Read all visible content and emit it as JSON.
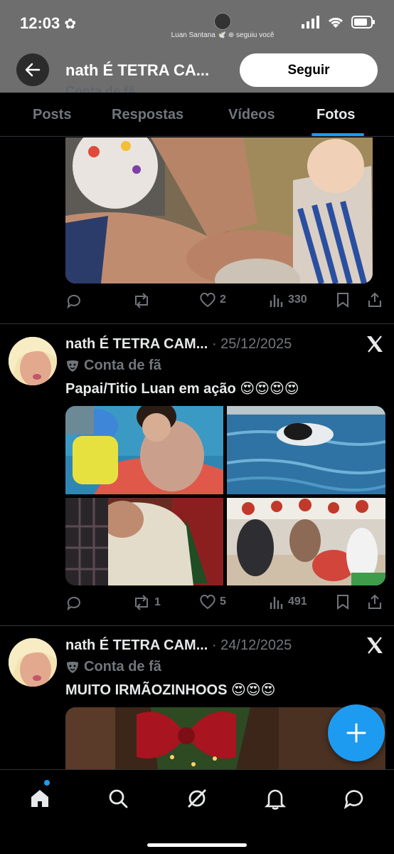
{
  "status_bar": {
    "time": "12:03"
  },
  "notification": {
    "text": "Luan Santana 🕊️ ⊕ seguiu você"
  },
  "header": {
    "title": "nath É TETRA CA...",
    "follow_label": "Seguir",
    "subtitle": "Conta de fã"
  },
  "tabs": [
    {
      "label": "Posts"
    },
    {
      "label": "Respostas"
    },
    {
      "label": "Vídeos"
    },
    {
      "label": "Fotos",
      "active": true
    }
  ],
  "posts": [
    {
      "actions": {
        "replies": "",
        "reposts": "",
        "likes": "2",
        "views": "330"
      }
    },
    {
      "author": "nath É TETRA CAM...",
      "date": "· 25/12/2025",
      "badge": "Conta de fã",
      "text": "Papai/Titio Luan em ação 😍😍😍😍",
      "actions": {
        "replies": "",
        "reposts": "1",
        "likes": "5",
        "views": "491"
      }
    },
    {
      "author": "nath É TETRA CAM...",
      "date": "· 24/12/2025",
      "badge": "Conta de fã",
      "text": "MUITO IRMÃOZINHOOS 😍😍😍"
    }
  ],
  "colors": {
    "accent": "#1d9bf0",
    "muted": "#71767b",
    "header_bg": "#6e6e6e"
  },
  "bottom_nav": [
    "home-icon",
    "search-icon",
    "grok-icon",
    "notifications-icon",
    "messages-icon"
  ]
}
